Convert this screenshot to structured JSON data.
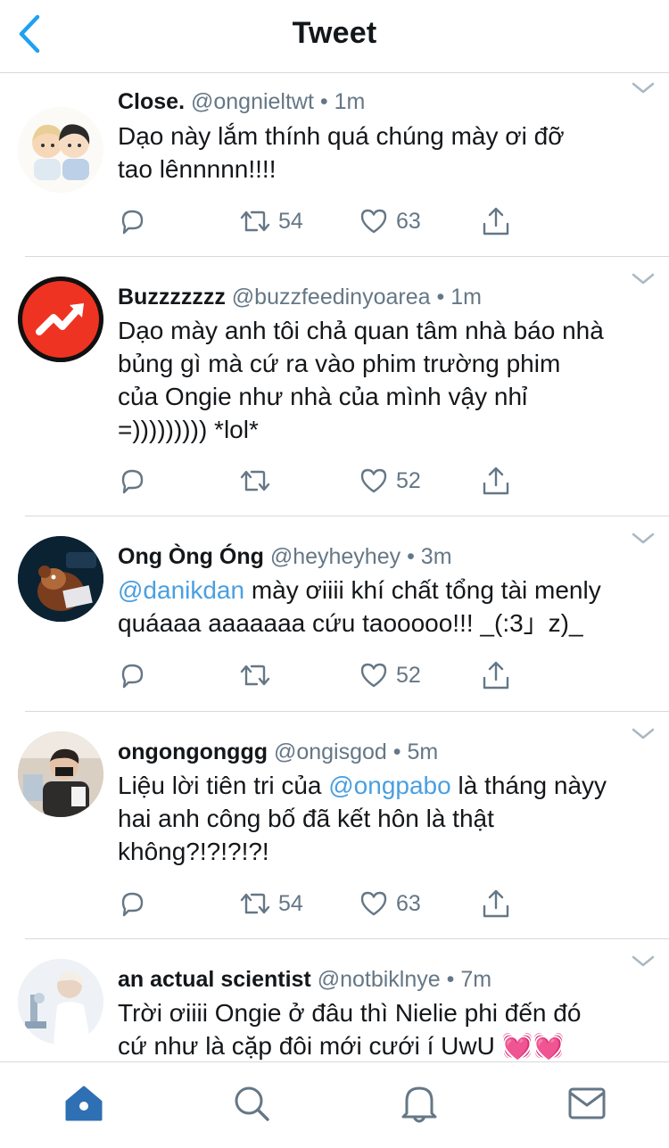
{
  "header": {
    "title": "Tweet"
  },
  "tweets": [
    {
      "name": "Close.",
      "handle": "@ongnieltwt",
      "dot": "•",
      "time": "1m",
      "text_lines": [
        "Dạo này lắm thính quá chúng mày ơi đỡ",
        "tao lênnnnn!!!!"
      ],
      "retweets": "54",
      "likes": "63"
    },
    {
      "name": "Buzzzzzzz",
      "handle": "@buzzfeedinyoarea",
      "dot": "•",
      "time": "1m",
      "text_lines": [
        "Dạo mày anh tôi chả quan tâm nhà báo nhà",
        "bủng gì mà cứ ra vào phim trường phim",
        "của Ongie như nhà của mình vậy nhỉ",
        "=))))))))) *lol*"
      ],
      "retweets": "",
      "likes": "52"
    },
    {
      "name": "Ong Òng Óng",
      "handle": "@heyheyhey",
      "dot": "•",
      "time": "3m",
      "mention": "@danikdan",
      "text_line1_rest": " mày ơiiii khí chất tổng tài menly",
      "text_line2": "quáaaa aaaaaaa cứu taooooo!!! _(:3」z)_",
      "retweets": "",
      "likes": "52"
    },
    {
      "name": "ongongonggg",
      "handle": "@ongisgod",
      "dot": "•",
      "time": "5m",
      "text_line1_pre": "Liệu lời tiên tri của ",
      "mention": "@ongpabo",
      "text_line1_post": " là tháng nàyy",
      "text_line2": "hai anh công bố đã kết hôn là thật",
      "text_line3": "không?!?!?!?!",
      "retweets": "54",
      "likes": "63"
    },
    {
      "name": "an actual scientist",
      "handle": "@notbiklnye",
      "dot": "•",
      "time": "7m",
      "text_line1": "Trời ơiiii Ongie ở đâu thì Nielie phi đến đó",
      "text_line2": "cứ như là cặp đôi mới cưới í UwU ",
      "emoji": "💓💓"
    }
  ],
  "icons": {
    "back": "chevron-left-icon",
    "reply": "reply-icon",
    "retweet": "retweet-icon",
    "like": "heart-icon",
    "share": "share-icon",
    "caret": "chevron-down-icon",
    "home": "home-icon",
    "search": "search-icon",
    "notifications": "bell-icon",
    "messages": "mail-icon"
  },
  "colors": {
    "accent": "#1da1f2",
    "tab_active": "#2f6fb4",
    "tab_inactive": "#657786",
    "mention": "#4a9fe0",
    "muted": "#657786",
    "buzzfeed_red": "#ee3322"
  }
}
